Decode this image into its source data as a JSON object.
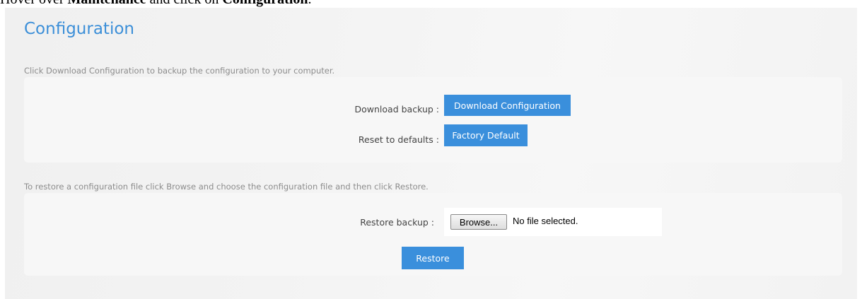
{
  "instruction": {
    "prefix": "Hover over ",
    "menu": "Maintenance",
    "middle": " and click on ",
    "item": "Configuration",
    "suffix": "."
  },
  "page": {
    "title": "Configuration"
  },
  "backup_section": {
    "description": "Click Download Configuration to backup the configuration to your computer.",
    "download_label": "Download backup :",
    "download_button": "Download Configuration",
    "reset_label": "Reset to defaults :",
    "reset_button": "Factory Default"
  },
  "restore_section": {
    "description": "To restore a configuration file click Browse and choose the configuration file and then click Restore.",
    "restore_label": "Restore backup :",
    "browse_button": "Browse...",
    "file_status": "No file selected.",
    "restore_button": "Restore"
  },
  "colors": {
    "accent": "#3a8fdc",
    "title": "#3c8fd8"
  }
}
